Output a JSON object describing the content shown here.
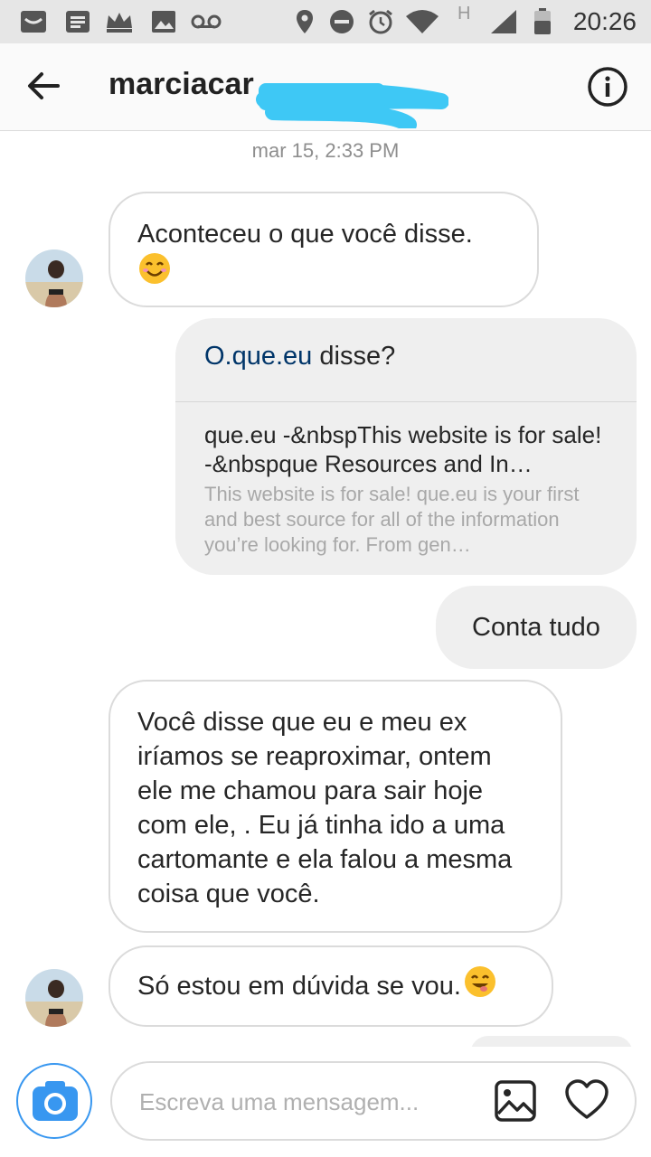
{
  "status_bar": {
    "time": "20:26",
    "network_letter": "H",
    "icons": [
      "inbox-icon",
      "message-icon",
      "crown-icon",
      "image-icon",
      "voicemail-icon",
      "location-icon",
      "do-not-disturb-icon",
      "alarm-icon",
      "wifi-icon",
      "signal-icon",
      "battery-icon"
    ]
  },
  "header": {
    "contact_name": "marciacar",
    "back_icon": "arrow-left-icon",
    "info_icon": "info-icon"
  },
  "conversation": {
    "timestamp": "mar 15, 2:33 PM",
    "messages": [
      {
        "from": "them",
        "text": "Aconteceu o que você disse.",
        "emoji": "smiling-face-icon"
      },
      {
        "from": "me",
        "link_text": "O.que.eu",
        "text_after": " disse?",
        "preview_title": "que.eu -&nbspThis website is for sale! -&nbspque Resources and In…",
        "preview_desc": "This website is for sale! que.eu is your first and best source for all of the information you’re looking for. From gen…"
      },
      {
        "from": "me",
        "text": "Conta tudo"
      },
      {
        "from": "them",
        "text": "Você disse que eu e meu ex iríamos se reaproximar, ontem ele me chamou para sair hoje com ele, . Eu já tinha ido a uma cartomante e ela falou a mesma coisa que você."
      },
      {
        "from": "them",
        "text": "Só estou em dúvida se vou.",
        "emoji": "savoring-face-icon"
      }
    ]
  },
  "composer": {
    "placeholder": "Escreva uma mensagem...",
    "camera_icon": "camera-icon",
    "gallery_icon": "gallery-icon",
    "like_icon": "heart-icon"
  },
  "colors": {
    "accent_blue": "#3897f0",
    "link_blue": "#003569",
    "bubble_gray": "#efefef",
    "border": "#dbdbdb",
    "status_bar": "#e6e6e6",
    "redaction": "#3ec8f5"
  }
}
